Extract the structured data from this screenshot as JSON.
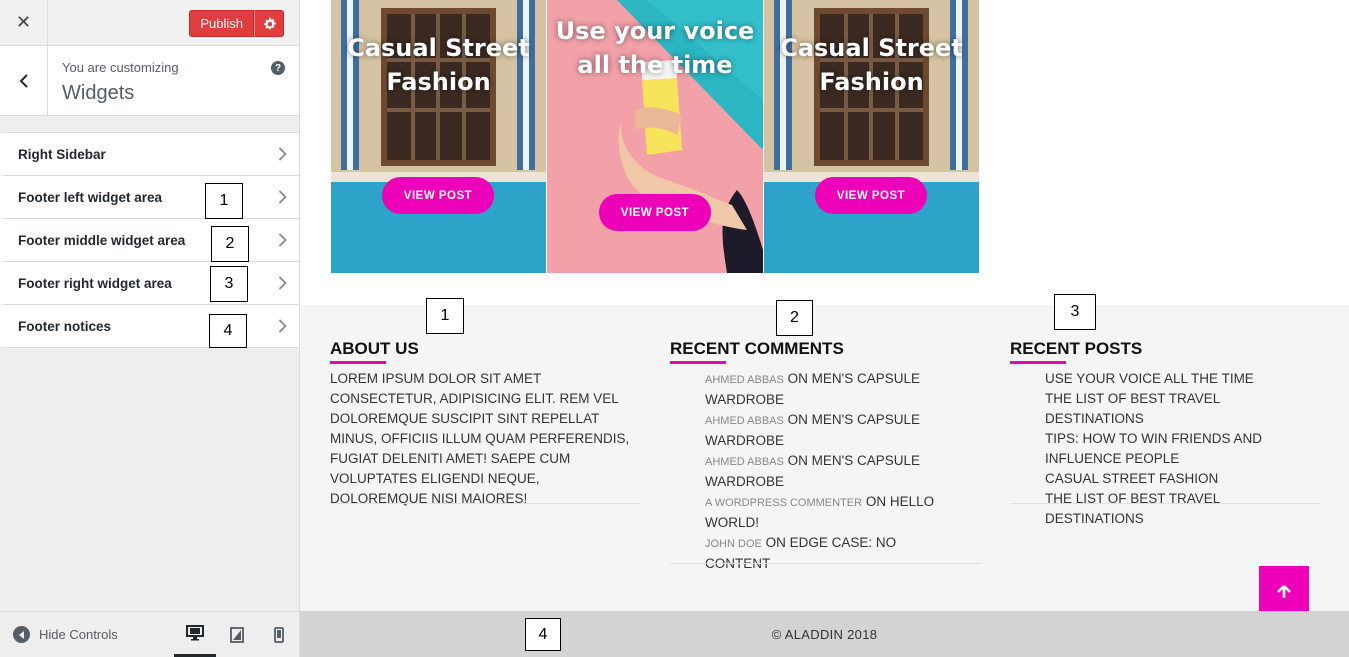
{
  "customizer": {
    "publish_label": "Publish",
    "customizing_label": "You are customizing",
    "section_title": "Widgets",
    "items": [
      {
        "label": "Right Sidebar"
      },
      {
        "label": "Footer left widget area"
      },
      {
        "label": "Footer middle widget area"
      },
      {
        "label": "Footer right widget area"
      },
      {
        "label": "Footer notices"
      }
    ],
    "hide_controls_label": "Hide Controls"
  },
  "annotations": [
    "1",
    "2",
    "3",
    "4"
  ],
  "preview": {
    "cards": [
      {
        "title": "Casual Street Fashion",
        "button": "VIEW POST"
      },
      {
        "title": "Use your voice all the time",
        "button": "VIEW POST"
      },
      {
        "title": "Casual Street Fashion",
        "button": "VIEW POST"
      }
    ],
    "about": {
      "title": "ABOUT US",
      "text": "LOREM IPSUM DOLOR SIT AMET CONSECTETUR, ADIPISICING ELIT. REM VEL DOLOREMQUE SUSCIPIT SINT REPELLAT MINUS, OFFICIIS ILLUM QUAM PERFERENDIS, FUGIAT DELENITI AMET! SAEPE CUM VOLUPTATES ELIGENDI NEQUE, DOLOREMQUE NISI MAIORES!"
    },
    "recent_comments": {
      "title": "RECENT COMMENTS",
      "items": [
        {
          "author": "AHMED ABBAS",
          "on": "ON",
          "post": "MEN'S CAPSULE WARDROBE"
        },
        {
          "author": "AHMED ABBAS",
          "on": "ON",
          "post": "MEN'S CAPSULE WARDROBE"
        },
        {
          "author": "AHMED ABBAS",
          "on": "ON",
          "post": "MEN'S CAPSULE WARDROBE"
        },
        {
          "author": "A WORDPRESS COMMENTER",
          "on": "ON",
          "post": "HELLO WORLD!"
        },
        {
          "author": "JOHN DOE",
          "on": "ON",
          "post": "EDGE CASE: NO CONTENT"
        }
      ]
    },
    "recent_posts": {
      "title": "RECENT POSTS",
      "items": [
        "USE YOUR VOICE ALL THE TIME",
        "THE LIST OF BEST TRAVEL DESTINATIONS",
        "TIPS: HOW TO WIN FRIENDS AND INFLUENCE PEOPLE",
        "CASUAL STREET FASHION",
        "THE LIST OF BEST TRAVEL DESTINATIONS"
      ]
    },
    "copyright": "© ALADDIN 2018"
  },
  "colors": {
    "accent": "#ec00b8",
    "publish": "#e23d3d",
    "wall_blue": "#2ea3c9",
    "wall_pink": "#f2a1a8"
  }
}
